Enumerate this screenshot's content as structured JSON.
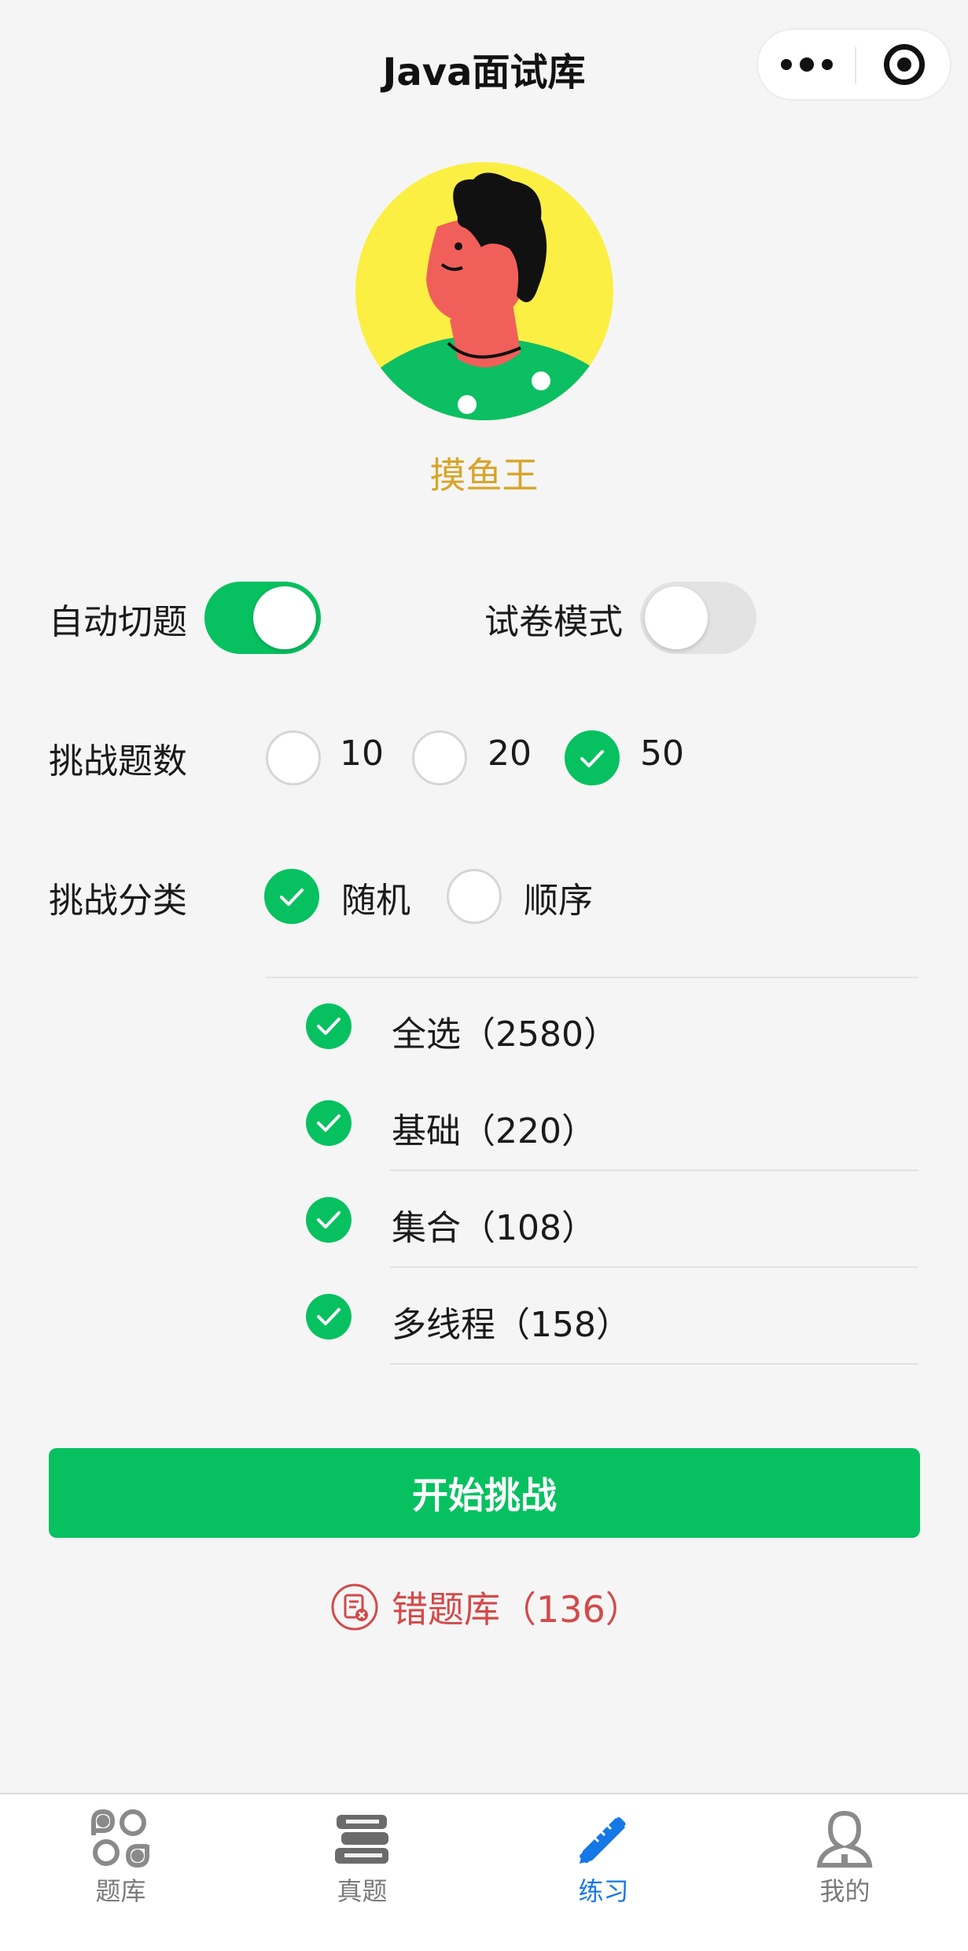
{
  "header": {
    "title": "Java面试库"
  },
  "profile": {
    "username": "摸鱼王"
  },
  "settings": {
    "auto_switch": {
      "label": "自动切题",
      "on": true
    },
    "exam_mode": {
      "label": "试卷模式",
      "on": false
    }
  },
  "challenge_count": {
    "label": "挑战题数",
    "options": [
      {
        "label": "10",
        "checked": false
      },
      {
        "label": "20",
        "checked": false
      },
      {
        "label": "50",
        "checked": true
      }
    ]
  },
  "challenge_category": {
    "label": "挑战分类",
    "options": [
      {
        "label": "随机",
        "checked": true
      },
      {
        "label": "顺序",
        "checked": false
      }
    ],
    "categories": [
      {
        "label": "全选（2580）",
        "checked": true
      },
      {
        "label": "基础（220）",
        "checked": true
      },
      {
        "label": "集合（108）",
        "checked": true
      },
      {
        "label": "多线程（158）",
        "checked": true
      }
    ]
  },
  "actions": {
    "start_label": "开始挑战",
    "wrong_bank_label": "错题库（136）"
  },
  "tabbar": {
    "tabs": [
      {
        "label": "题库",
        "icon": "clover-grid-icon",
        "active": false
      },
      {
        "label": "真题",
        "icon": "book-stack-icon",
        "active": false
      },
      {
        "label": "练习",
        "icon": "pencil-ruler-icon",
        "active": true
      },
      {
        "label": "我的",
        "icon": "person-icon",
        "active": false
      }
    ]
  },
  "colors": {
    "accent": "#07c160",
    "username": "#d7a529",
    "wrong": "#d24a4a",
    "tab_active": "#1677e6"
  }
}
